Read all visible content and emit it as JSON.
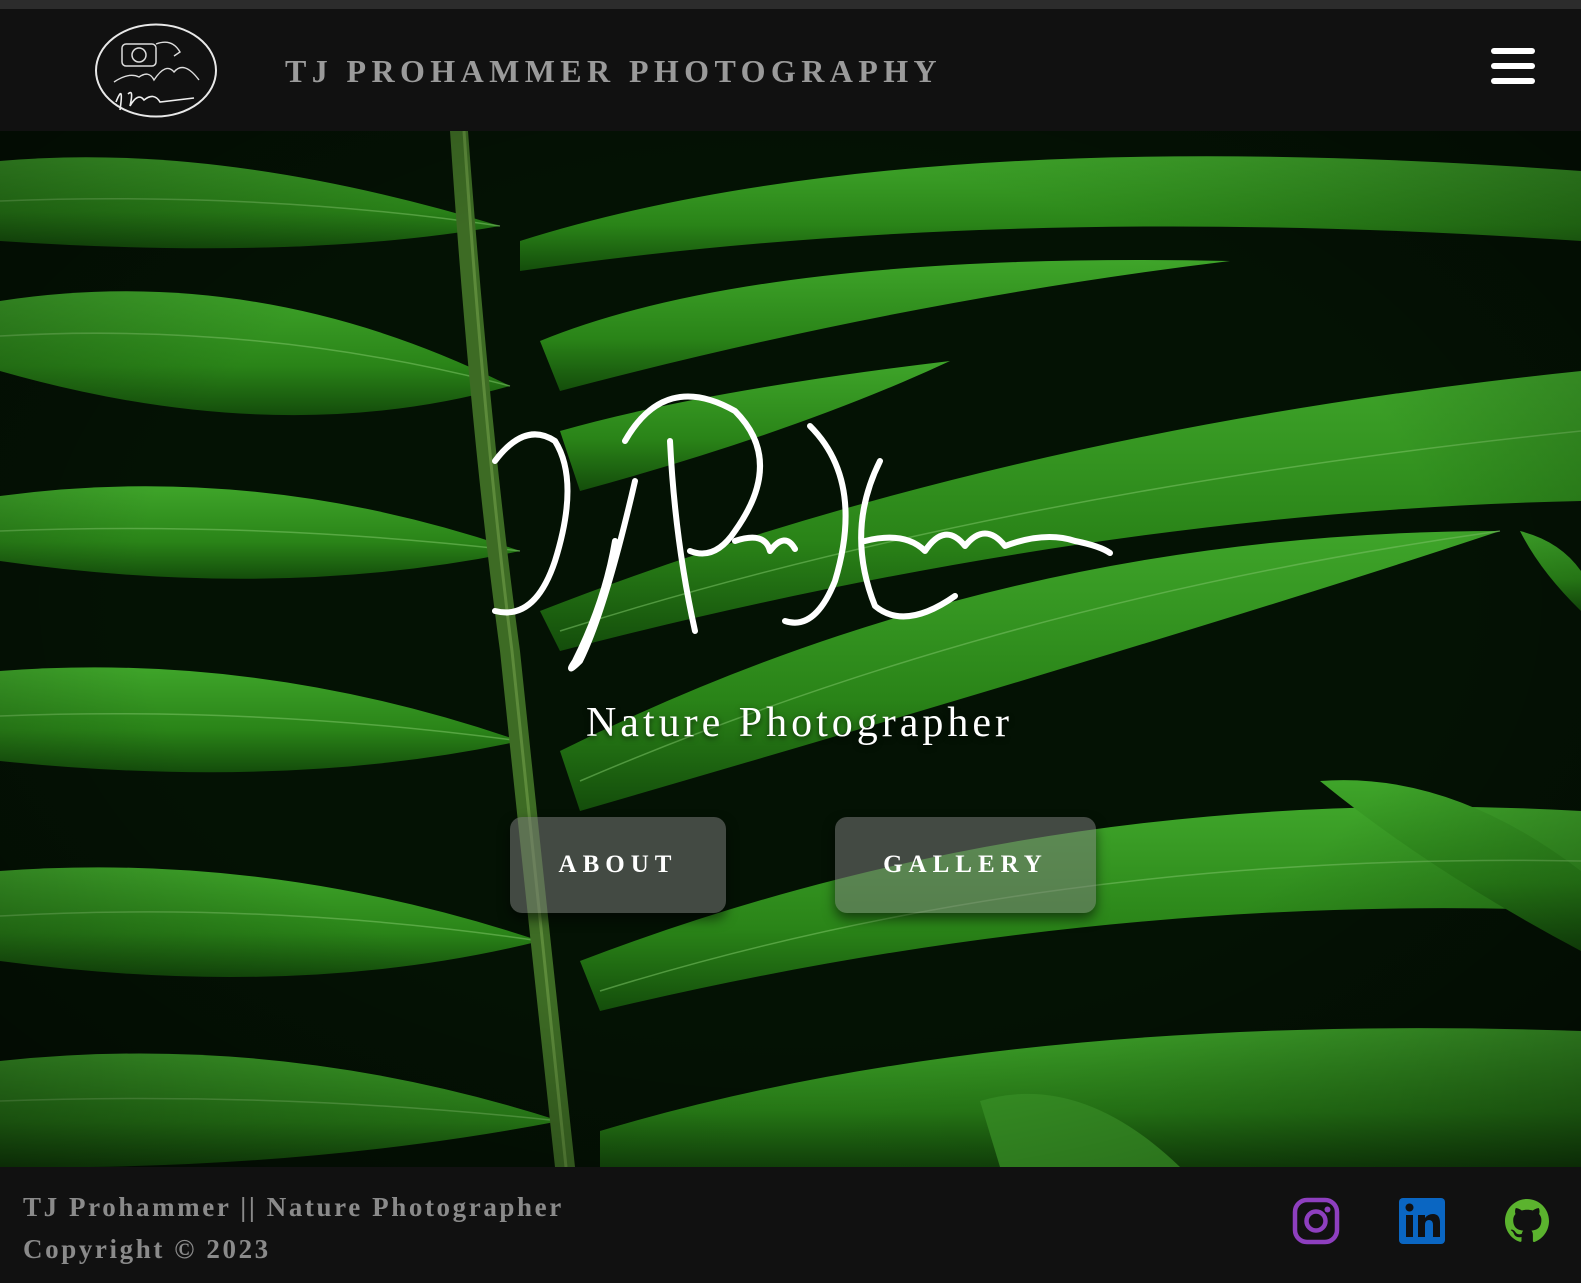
{
  "header": {
    "site_title": "TJ PROHAMMER PHOTOGRAPHY",
    "logo_icon": "camera-signature-logo",
    "menu_icon": "hamburger-menu-icon"
  },
  "hero": {
    "tagline": "Nature Photographer",
    "buttons": {
      "about": "ABOUT",
      "gallery": "GALLERY"
    },
    "background": "fern-leaf-photo"
  },
  "footer": {
    "line1": "TJ Prohammer || Nature Photographer",
    "line2": "Copyright © 2023",
    "social": [
      {
        "name": "instagram-icon",
        "color": "#8e3fbf"
      },
      {
        "name": "linkedin-icon",
        "color": "#0a66c2"
      },
      {
        "name": "github-icon",
        "color": "#5bb32e"
      }
    ]
  },
  "colors": {
    "nav_bg": "#111111",
    "title": "#9a9a9a",
    "footer_text": "#8a8a8a",
    "leaf_green": "#2f8f1f"
  }
}
